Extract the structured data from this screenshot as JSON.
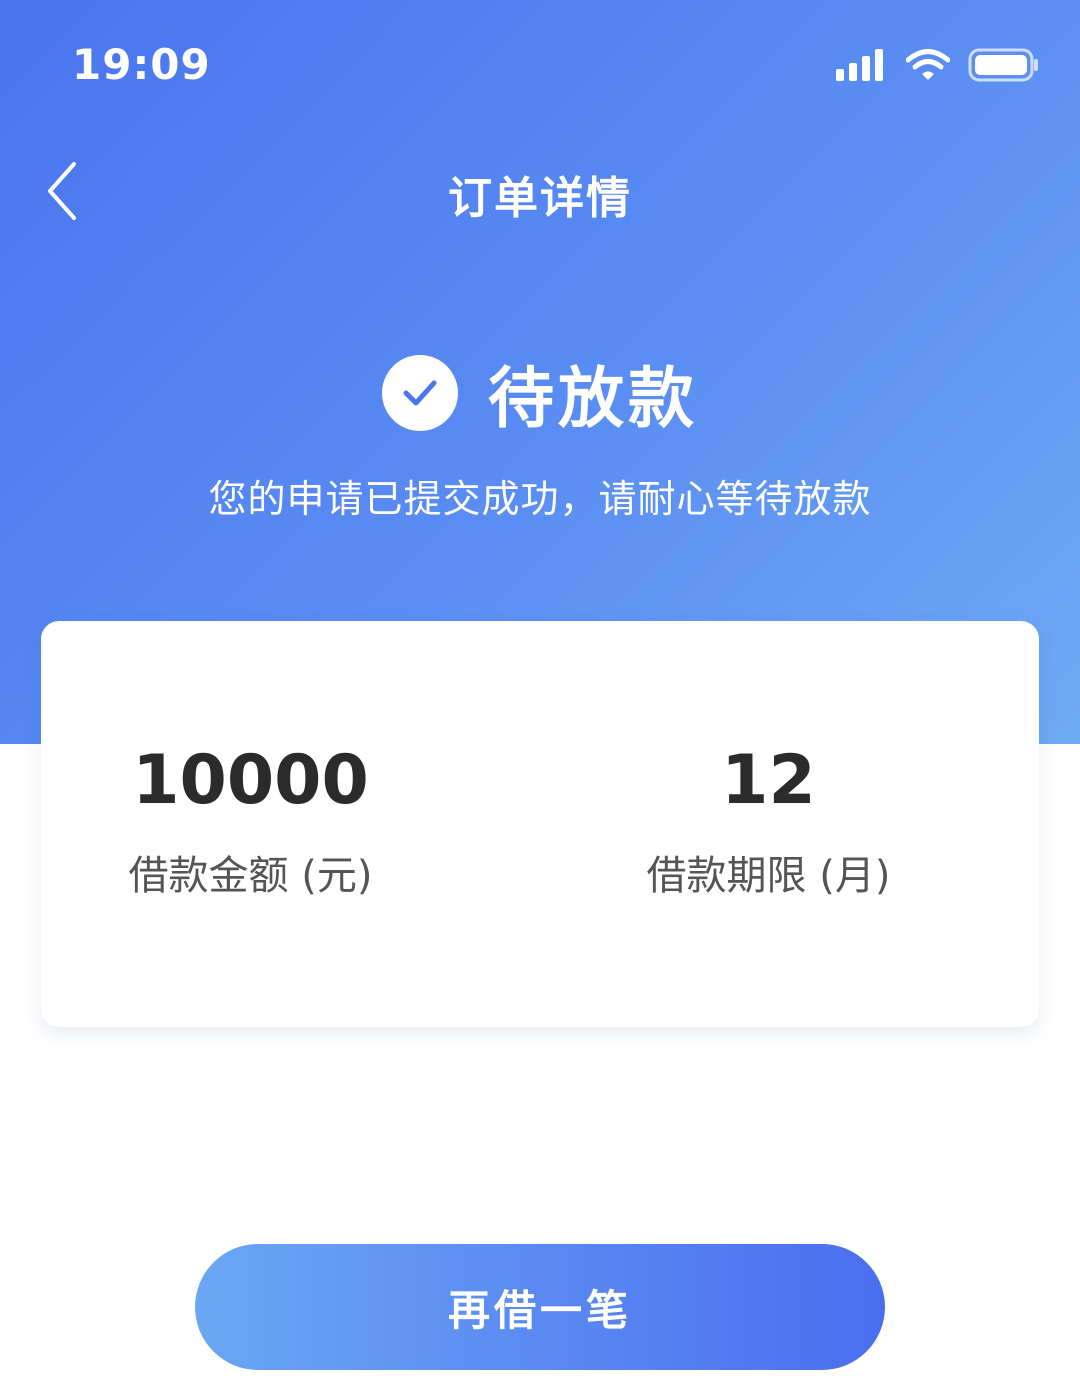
{
  "status_bar": {
    "time": "19:09",
    "icons": [
      "signal-icon",
      "wifi-icon",
      "battery-icon"
    ]
  },
  "nav": {
    "title": "订单详情",
    "back_icon": "chevron-left-icon"
  },
  "order_status": {
    "icon": "check-circle-icon",
    "title": "待放款",
    "subtitle": "您的申请已提交成功，请耐心等待放款"
  },
  "loan_summary": {
    "amount": {
      "value": "10000",
      "label": "借款金额 (元)"
    },
    "term": {
      "value": "12",
      "label": "借款期限 (月)"
    }
  },
  "actions": {
    "borrow_again_label": "再借一笔"
  },
  "colors": {
    "hero_start": "#4a74f0",
    "hero_end": "#6faaf4",
    "check_color": "#4a74f0",
    "value_text": "#2b2b2b",
    "label_text": "#555555"
  }
}
